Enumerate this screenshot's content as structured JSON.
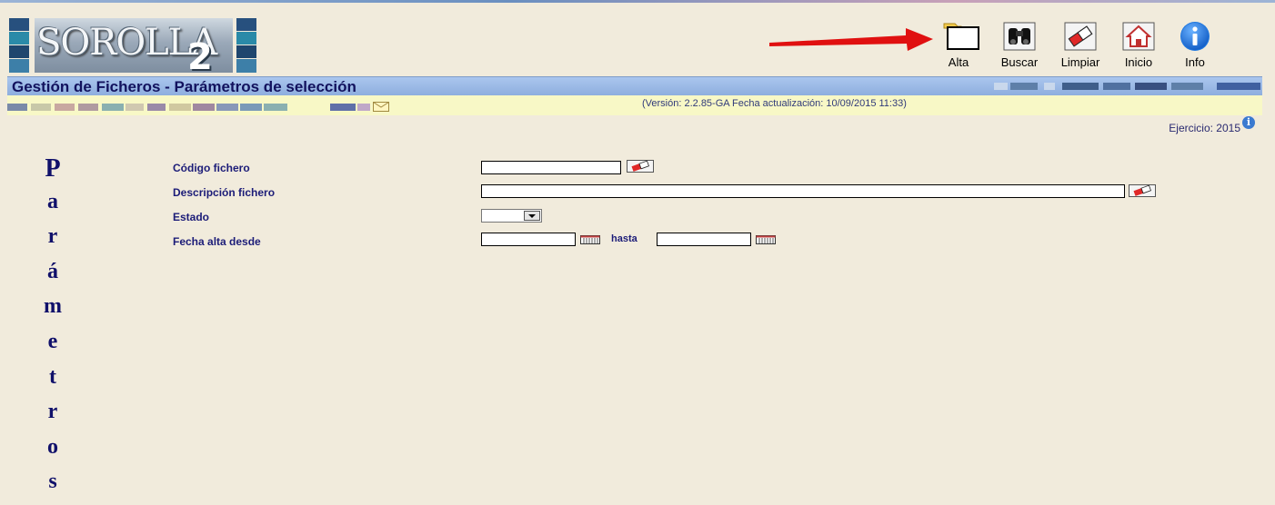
{
  "app": {
    "logo_text": "SOROLLA",
    "logo_number": "2"
  },
  "toolbar": {
    "alta": "Alta",
    "buscar": "Buscar",
    "limpiar": "Limpiar",
    "inicio": "Inicio",
    "info": "Info"
  },
  "header": {
    "title": "Gestión de Ficheros - Parámetros de selección",
    "version": "(Versión: 2.2.85-GA Fecha actualización: 10/09/2015 11:33)",
    "ejercicio": "Ejercicio: 2015"
  },
  "side_word": [
    "P",
    "a",
    "r",
    "á",
    "m",
    "e",
    "t",
    "r",
    "o",
    "s"
  ],
  "form": {
    "codigo_label": "Código fichero",
    "codigo_value": "",
    "descripcion_label": "Descripción fichero",
    "descripcion_value": "",
    "estado_label": "Estado",
    "estado_value": "",
    "fecha_label": "Fecha alta desde",
    "fecha_desde_value": "",
    "hasta_label": "hasta",
    "fecha_hasta_value": ""
  },
  "icons": [
    "folder-icon",
    "binoculars-icon",
    "eraser-icon",
    "home-icon",
    "info-icon",
    "calendar-icon",
    "mail-icon"
  ],
  "colors": {
    "background": "#f1ebdc",
    "title_bar": "#9bbbe8",
    "sub_bar": "#f8f8c6",
    "label_text": "#1c1c78",
    "arrow": "#e01010"
  }
}
